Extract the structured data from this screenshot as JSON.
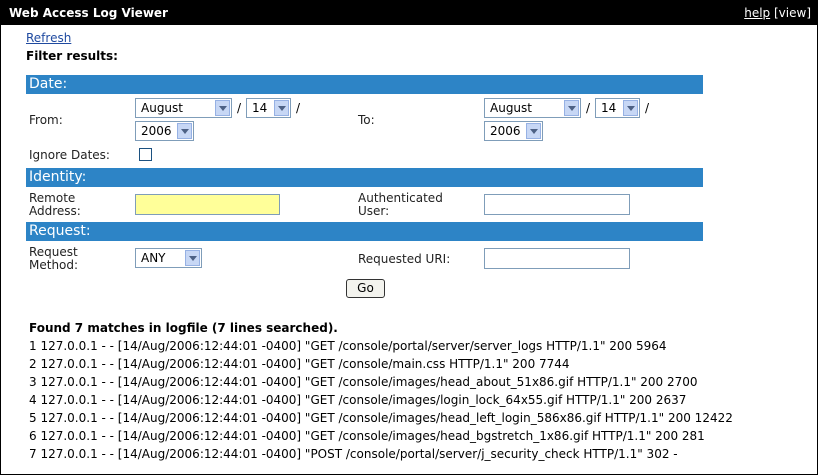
{
  "window": {
    "title": "Web Access Log Viewer",
    "help_label": "help",
    "view_label": "[view]"
  },
  "refresh_label": "Refresh",
  "filter_label": "Filter results:",
  "sections": {
    "date": "Date:",
    "identity": "Identity:",
    "request": "Request:"
  },
  "date": {
    "from_label": "From:",
    "to_label": "To:",
    "from": {
      "month": "August",
      "day": "14",
      "year": "2006"
    },
    "to": {
      "month": "August",
      "day": "14",
      "year": "2006"
    },
    "slash": "/",
    "ignore_label": "Ignore Dates:",
    "ignore_checked": false
  },
  "identity": {
    "remote_label_1": "Remote",
    "remote_label_2": "Address:",
    "remote_value": "",
    "auth_label_1": "Authenticated",
    "auth_label_2": "User:",
    "auth_value": ""
  },
  "request": {
    "method_label_1": "Request",
    "method_label_2": "Method:",
    "method_value": "ANY",
    "uri_label": "Requested URI:",
    "uri_value": ""
  },
  "go_label": "Go",
  "results_summary": "Found 7 matches in logfile (7 lines searched).",
  "log_lines": [
    "1 127.0.0.1 - - [14/Aug/2006:12:44:01 -0400] \"GET /console/portal/server/server_logs HTTP/1.1\" 200 5964",
    "2 127.0.0.1 - - [14/Aug/2006:12:44:01 -0400] \"GET /console/main.css HTTP/1.1\" 200 7744",
    "3 127.0.0.1 - - [14/Aug/2006:12:44:01 -0400] \"GET /console/images/head_about_51x86.gif HTTP/1.1\" 200 2700",
    "4 127.0.0.1 - - [14/Aug/2006:12:44:01 -0400] \"GET /console/images/login_lock_64x55.gif HTTP/1.1\" 200 2637",
    "5 127.0.0.1 - - [14/Aug/2006:12:44:01 -0400] \"GET /console/images/head_left_login_586x86.gif HTTP/1.1\" 200 12422",
    "6 127.0.0.1 - - [14/Aug/2006:12:44:01 -0400] \"GET /console/images/head_bgstretch_1x86.gif HTTP/1.1\" 200 281",
    "7 127.0.0.1 - - [14/Aug/2006:12:44:01 -0400] \"POST /console/portal/server/j_security_check HTTP/1.1\" 302 -"
  ]
}
